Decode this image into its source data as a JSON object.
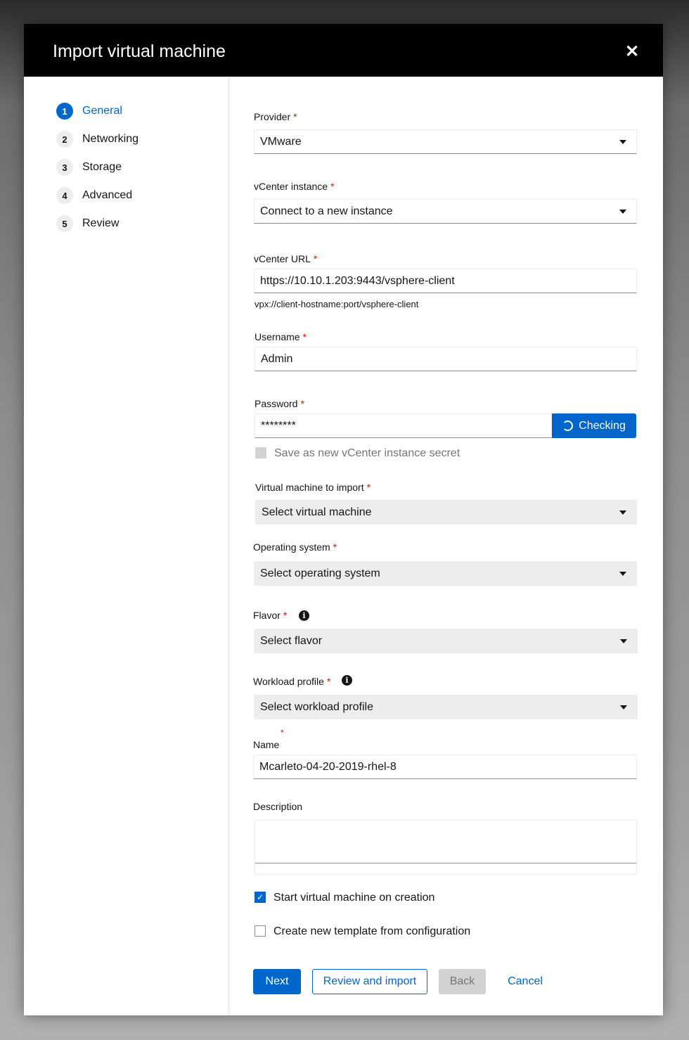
{
  "modal": {
    "title": "Import virtual machine",
    "close_icon": "close-icon"
  },
  "steps": [
    {
      "number": "1",
      "label": "General",
      "active": true
    },
    {
      "number": "2",
      "label": "Networking"
    },
    {
      "number": "3",
      "label": "Storage"
    },
    {
      "number": "4",
      "label": "Advanced"
    },
    {
      "number": "5",
      "label": "Review"
    }
  ],
  "form": {
    "required_mark": "*",
    "provider": {
      "label": "Provider",
      "value": "VMware"
    },
    "vcenter_instance": {
      "label": "vCenter instance",
      "value": "Connect to a new instance"
    },
    "vcenter_url": {
      "label": "vCenter URL",
      "value": "https://10.10.1.203:9443/vsphere-client",
      "helper": "vpx://client-hostname:port/vsphere-client"
    },
    "username": {
      "label": "Username",
      "value": "Admin"
    },
    "password": {
      "label": "Password",
      "value": "********",
      "check_button": "Checking"
    },
    "save_secret": {
      "label": "Save as new vCenter instance secret",
      "checked": false,
      "disabled": true
    },
    "vm_to_import": {
      "label": "Virtual machine to import",
      "placeholder": "Select virtual machine"
    },
    "operating_system": {
      "label": "Operating system",
      "placeholder": "Select operating system"
    },
    "flavor": {
      "label": "Flavor",
      "placeholder": "Select flavor"
    },
    "workload_profile": {
      "label": "Workload profile",
      "placeholder": "Select workload profile"
    },
    "name": {
      "label": "Name",
      "value": "Mcarleto-04-20-2019-rhel-8"
    },
    "description": {
      "label": "Description",
      "value": ""
    },
    "start_on_creation": {
      "label": "Start virtual machine on creation",
      "checked": true
    },
    "create_template": {
      "label": "Create new template from configuration",
      "checked": false
    }
  },
  "footer": {
    "next": "Next",
    "review_import": "Review and import",
    "back": "Back",
    "cancel": "Cancel"
  },
  "colors": {
    "primary": "#0066cc",
    "header": "#000000",
    "required": "#c9190b"
  }
}
